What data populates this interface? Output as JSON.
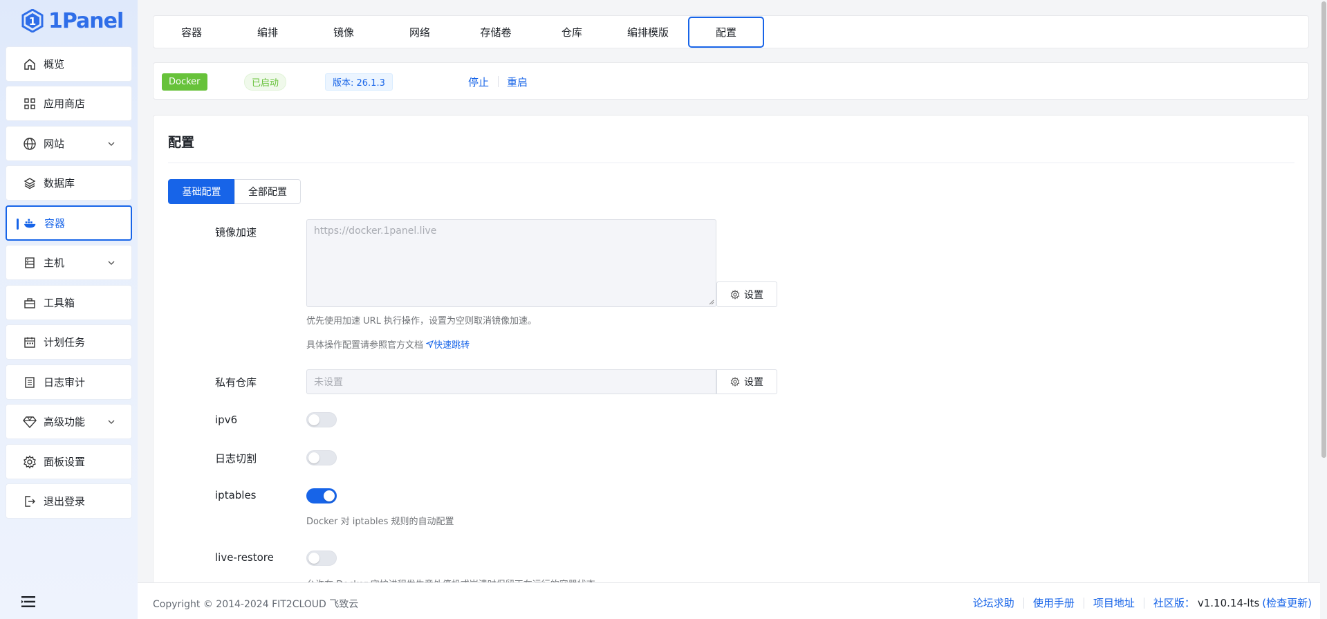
{
  "app": {
    "logo_text": "1Panel"
  },
  "sidebar": {
    "items": [
      {
        "label": "概览",
        "icon": "home-icon"
      },
      {
        "label": "应用商店",
        "icon": "grid-icon"
      },
      {
        "label": "网站",
        "icon": "globe-icon",
        "expandable": true
      },
      {
        "label": "数据库",
        "icon": "layers-icon"
      },
      {
        "label": "容器",
        "icon": "docker-icon",
        "active": true
      },
      {
        "label": "主机",
        "icon": "server-icon",
        "expandable": true
      },
      {
        "label": "工具箱",
        "icon": "toolbox-icon"
      },
      {
        "label": "计划任务",
        "icon": "calendar-icon"
      },
      {
        "label": "日志审计",
        "icon": "log-icon"
      },
      {
        "label": "高级功能",
        "icon": "diamond-icon",
        "expandable": true
      },
      {
        "label": "面板设置",
        "icon": "gear-icon"
      },
      {
        "label": "退出登录",
        "icon": "logout-icon"
      }
    ]
  },
  "tabs": [
    "容器",
    "编排",
    "镜像",
    "网络",
    "存储卷",
    "仓库",
    "编排模版",
    "配置"
  ],
  "active_tab": "配置",
  "status": {
    "docker": "Docker",
    "state": "已启动",
    "version": "版本: 26.1.3",
    "stop": "停止",
    "restart": "重启"
  },
  "panel": {
    "title": "配置",
    "seg_basic": "基础配置",
    "seg_all": "全部配置",
    "mirror_label": "镜像加速",
    "mirror_placeholder": "https://docker.1panel.live",
    "set_label": "设置",
    "mirror_hint": "优先使用加速 URL 执行操作，设置为空则取消镜像加速。",
    "mirror_doc": "具体操作配置请参照官方文档",
    "mirror_link": "快速跳转",
    "registry_label": "私有仓库",
    "registry_value": "未设置",
    "ipv6_label": "ipv6",
    "ipv6_on": false,
    "logcut_label": "日志切割",
    "logcut_on": false,
    "iptables_label": "iptables",
    "iptables_on": true,
    "iptables_hint": "Docker 对 iptables 规则的自动配置",
    "live_label": "live-restore",
    "live_on": false,
    "live_hint": "允许在 Docker 守护进程发生意外停机或崩溃时保留正在运行的容器状态"
  },
  "footer": {
    "copyright": "Copyright © 2014-2024 FIT2CLOUD 飞致云",
    "links": [
      "论坛求助",
      "使用手册",
      "项目地址"
    ],
    "edition": "社区版：",
    "version": "v1.10.14-lts",
    "check_update": "(检查更新)"
  },
  "colors": {
    "primary": "#1764e8",
    "success": "#67c23a"
  }
}
